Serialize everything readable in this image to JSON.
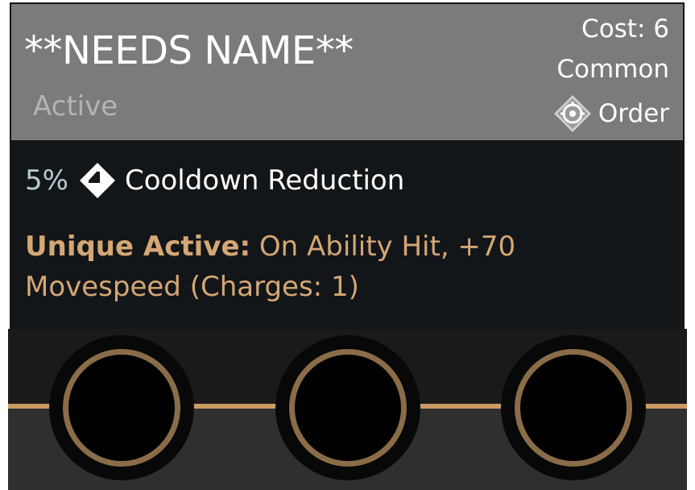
{
  "item": {
    "name": "**NEEDS NAME**",
    "type": "Active",
    "cost": "Cost: 6",
    "rarity": "Common",
    "category": "Order",
    "category_icon": "order-emblem-icon"
  },
  "stats": [
    {
      "value": "5%",
      "icon": "clock-icon",
      "label": "Cooldown Reduction"
    }
  ],
  "effect": {
    "lead": "Unique Active:",
    "text": " On Ability Hit, +70 Movespeed (Charges: 1)"
  },
  "slots": {
    "count": 3,
    "state": "empty"
  },
  "colors": {
    "header_bg": "#7b7b7b",
    "body_bg": "#131619",
    "effect_text": "#d4a774",
    "slot_ring": "#8a6d48",
    "divider": "#c99a61"
  }
}
